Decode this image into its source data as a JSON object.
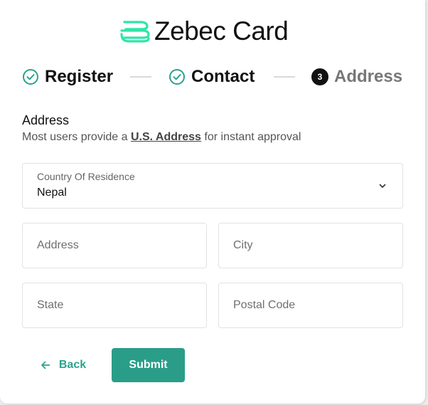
{
  "brand": {
    "name": "Zebec Card",
    "logo_icon": "zebec-logo-icon",
    "accent_color": "#2a9d88",
    "logo_color": "#2ee6a8"
  },
  "stepper": {
    "steps": [
      {
        "label": "Register",
        "status": "complete",
        "icon": "check-circle-icon"
      },
      {
        "label": "Contact",
        "status": "complete",
        "icon": "check-circle-icon"
      },
      {
        "label": "Address",
        "status": "current",
        "number": "3"
      }
    ]
  },
  "section": {
    "title": "Address",
    "subtitle_prefix": "Most users provide a ",
    "subtitle_link": "U.S. Address",
    "subtitle_suffix": " for instant approval"
  },
  "form": {
    "country": {
      "label": "Country Of Residence",
      "value": "Nepal",
      "icon": "chevron-down-icon"
    },
    "address": {
      "placeholder": "Address",
      "value": ""
    },
    "city": {
      "placeholder": "City",
      "value": ""
    },
    "state": {
      "placeholder": "State",
      "value": ""
    },
    "postal_code": {
      "placeholder": "Postal Code",
      "value": ""
    }
  },
  "actions": {
    "back_label": "Back",
    "back_icon": "arrow-left-icon",
    "submit_label": "Submit"
  }
}
